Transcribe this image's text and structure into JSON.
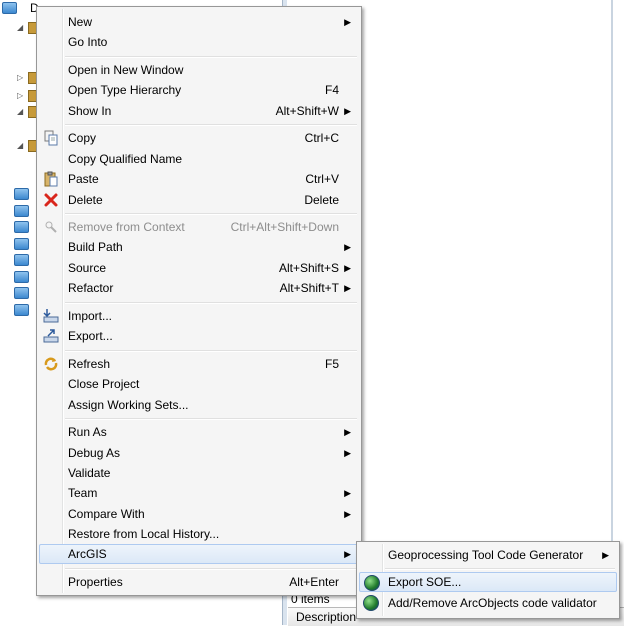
{
  "explorer": {
    "root_label": "D"
  },
  "right_panel": {
    "items_count": "0 items",
    "description_header": "Description"
  },
  "context_menu": {
    "new": "New",
    "go_into": "Go Into",
    "open_in_new_window": "Open in New Window",
    "open_type_hierarchy": "Open Type Hierarchy",
    "open_type_hierarchy_shortcut": "F4",
    "show_in": "Show In",
    "show_in_shortcut": "Alt+Shift+W",
    "copy": "Copy",
    "copy_shortcut": "Ctrl+C",
    "copy_qualified_name": "Copy Qualified Name",
    "paste": "Paste",
    "paste_shortcut": "Ctrl+V",
    "delete": "Delete",
    "delete_shortcut": "Delete",
    "remove_from_context": "Remove from Context",
    "remove_from_context_shortcut": "Ctrl+Alt+Shift+Down",
    "build_path": "Build Path",
    "source": "Source",
    "source_shortcut": "Alt+Shift+S",
    "refactor": "Refactor",
    "refactor_shortcut": "Alt+Shift+T",
    "import": "Import...",
    "export": "Export...",
    "refresh": "Refresh",
    "refresh_shortcut": "F5",
    "close_project": "Close Project",
    "assign_working_sets": "Assign Working Sets...",
    "run_as": "Run As",
    "debug_as": "Debug As",
    "validate": "Validate",
    "team": "Team",
    "compare_with": "Compare With",
    "restore_from_local_history": "Restore from Local History...",
    "arcgis": "ArcGIS",
    "properties": "Properties",
    "properties_shortcut": "Alt+Enter"
  },
  "arcgis_submenu": {
    "geoprocessing_tool_code_generator": "Geoprocessing Tool Code Generator",
    "export_soe": "Export SOE...",
    "add_remove_validator": "Add/Remove ArcObjects code validator"
  },
  "colors": {
    "menu_background": "#f5f5f5",
    "hover_border": "#aecaf0",
    "disabled_text": "#8d8d8d",
    "delete_icon": "#d9261c"
  }
}
